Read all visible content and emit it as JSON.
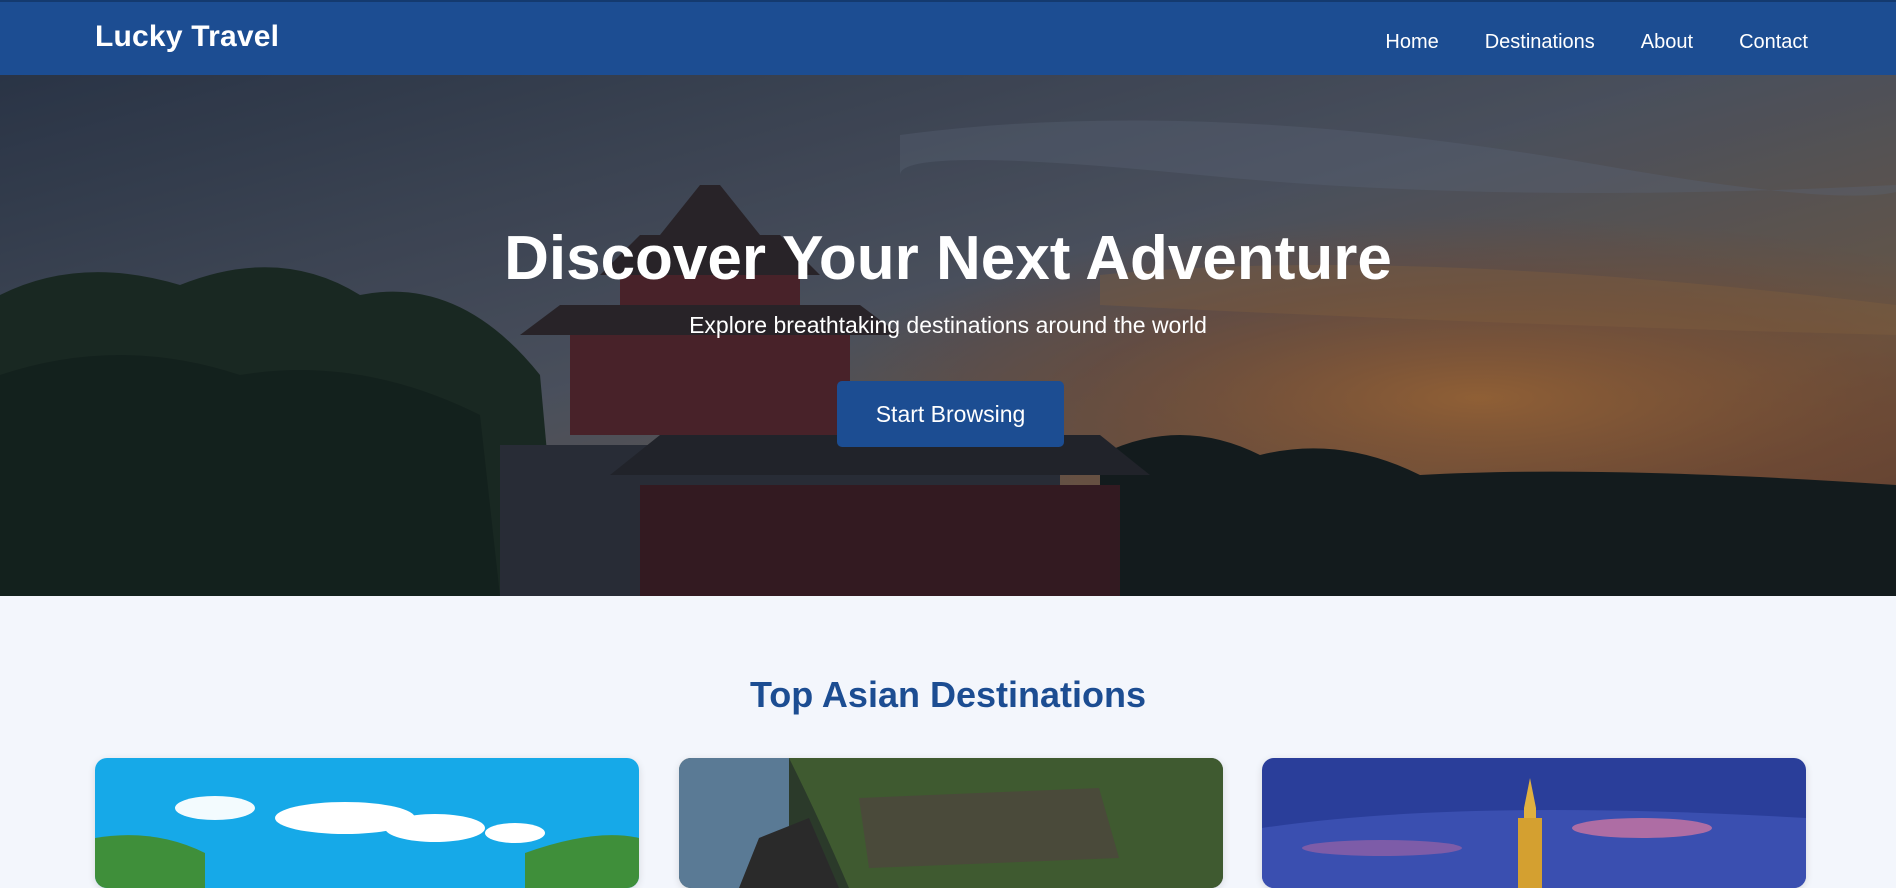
{
  "header": {
    "brand": "Lucky Travel",
    "nav": [
      "Home",
      "Destinations",
      "About",
      "Contact"
    ]
  },
  "hero": {
    "title": "Discover Your Next Adventure",
    "subtitle": "Explore breathtaking destinations around the world",
    "cta_label": "Start Browsing"
  },
  "destinations": {
    "heading": "Top Asian Destinations"
  },
  "colors": {
    "primary": "#1c4d92",
    "background": "#f3f6fc",
    "text_light": "#ffffff"
  }
}
